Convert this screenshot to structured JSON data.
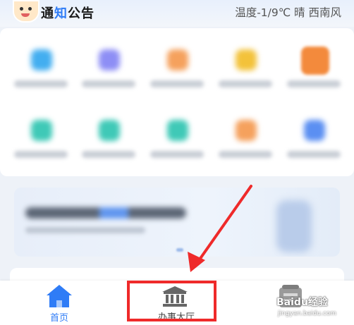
{
  "header": {
    "title_part1": "通",
    "title_part2": "知",
    "title_part3": "公告",
    "weather": "温度-1/9℃ 晴 西南风"
  },
  "grid": {
    "row1_colors": [
      "#43aef0",
      "#8d8ef5",
      "#f5a15d",
      "#f3c23a",
      "#f38a3c"
    ],
    "row2_colors": [
      "#3fc9b7",
      "#3fc9b7",
      "#3fc9b7",
      "#f5a15d",
      "#5b8ff2"
    ]
  },
  "nav": {
    "home_label": "首页",
    "hall_label": "办事大厅",
    "accent_color": "#2f7cf6"
  },
  "annotation": {
    "box_color": "#ef2a2a"
  },
  "watermark": {
    "text": "Baidu经验",
    "url": "jingyan.baidu.com"
  }
}
